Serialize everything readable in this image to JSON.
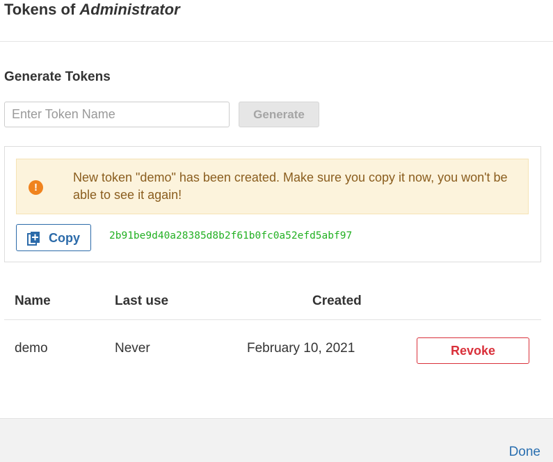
{
  "header": {
    "title_prefix": "Tokens of",
    "title_user": "Administrator"
  },
  "generate": {
    "section_title": "Generate Tokens",
    "input_placeholder": "Enter Token Name",
    "input_value": "",
    "generate_label": "Generate"
  },
  "alert": {
    "icon": "exclamation-circle-icon",
    "message": "New token \"demo\" has been created. Make sure you copy it now, you won't be able to see it again!"
  },
  "new_token": {
    "copy_label": "Copy",
    "copy_icon": "copy-icon",
    "value": "2b91be9d40a28385d8b2f61b0fc0a52efd5abf97"
  },
  "table": {
    "headers": {
      "name": "Name",
      "last_use": "Last use",
      "created": "Created"
    },
    "rows": [
      {
        "name": "demo",
        "last_use": "Never",
        "created": "February 10, 2021",
        "action_label": "Revoke"
      }
    ]
  },
  "footer": {
    "done_label": "Done"
  },
  "colors": {
    "primary": "#2b6aa9",
    "danger": "#d9303a",
    "warning_bg": "#fcf3dc",
    "warning_text": "#8a5d1e",
    "warning_icon": "#f0831e",
    "token_text": "#22b022"
  }
}
